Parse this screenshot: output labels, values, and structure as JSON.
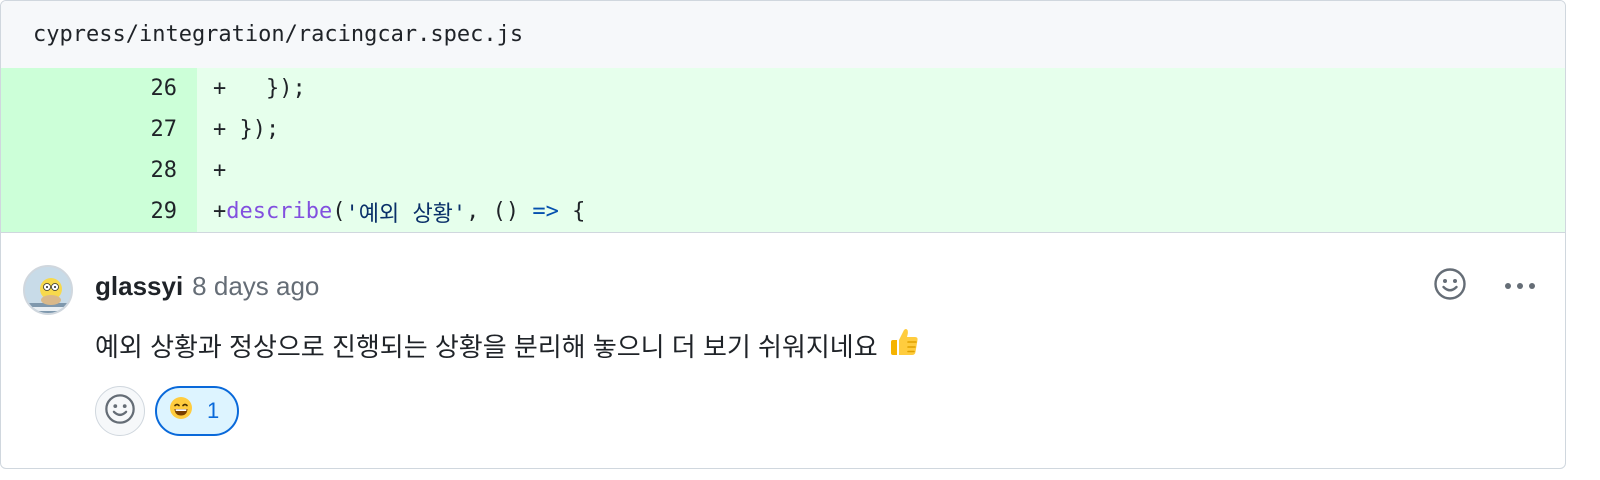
{
  "file": {
    "path": "cypress/integration/racingcar.spec.js"
  },
  "diff_lines": [
    {
      "num": "26",
      "marker": "+",
      "code": "   });"
    },
    {
      "num": "27",
      "marker": "+",
      "code": " });"
    },
    {
      "num": "28",
      "marker": "+",
      "code": ""
    },
    {
      "num": "29",
      "marker": "+",
      "code_fn": "describe",
      "code_open": "(",
      "code_str": "'예외 상황'",
      "code_mid": ", () ",
      "code_arrow": "=>",
      "code_end": " {"
    }
  ],
  "comment": {
    "author": "glassyi",
    "time": "8 days ago",
    "body": "예외 상황과 정상으로 진행되는 상황을 분리해 놓으니 더 보기 쉬워지네요",
    "body_emoji": "thumbs-up-emoji",
    "reactions": [
      {
        "emoji": "grinning-face-emoji",
        "count": "1"
      }
    ]
  },
  "icons": {
    "avatar": "avatar-image",
    "add_reaction": "smiley-icon",
    "more": "kebab-horizontal-icon"
  },
  "colors": {
    "addition_bg": "#e6ffec",
    "addition_num_bg": "#ccffd8",
    "accent": "#0969da"
  }
}
